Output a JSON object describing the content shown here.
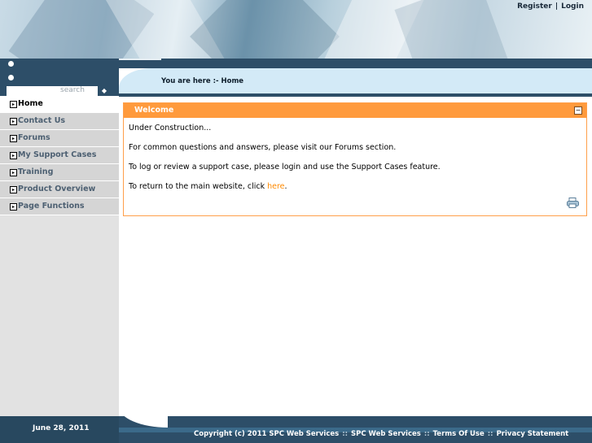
{
  "header": {
    "register_label": "Register",
    "separator": "|",
    "login_label": "Login"
  },
  "search": {
    "placeholder": "search"
  },
  "breadcrumb": "You are here :- Home",
  "sidebar": {
    "items": [
      {
        "label": "Home"
      },
      {
        "label": "Contact Us"
      },
      {
        "label": "Forums"
      },
      {
        "label": "My Support Cases"
      },
      {
        "label": "Training"
      },
      {
        "label": "Product Overview"
      },
      {
        "label": "Page Functions"
      }
    ]
  },
  "panel": {
    "title": "Welcome",
    "line1": "Under Construction...",
    "line2": "For common questions and answers, please visit our Forums section.",
    "line3": "To log or review a support case, please login and use the Support Cases feature.",
    "line4_prefix": "To return to the main website, click ",
    "line4_link": "here",
    "line4_suffix": "."
  },
  "footer": {
    "date": "June 28, 2011",
    "copyright": "Copyright (c) 2011 SPC Web Services",
    "link_company": "SPC Web Services",
    "link_terms": "Terms Of Use",
    "link_privacy": "Privacy Statement",
    "separator": "::"
  },
  "colors": {
    "accent_orange": "#ff9a3c",
    "link_orange": "#ff8a00",
    "dark_blue": "#2d4e68"
  }
}
